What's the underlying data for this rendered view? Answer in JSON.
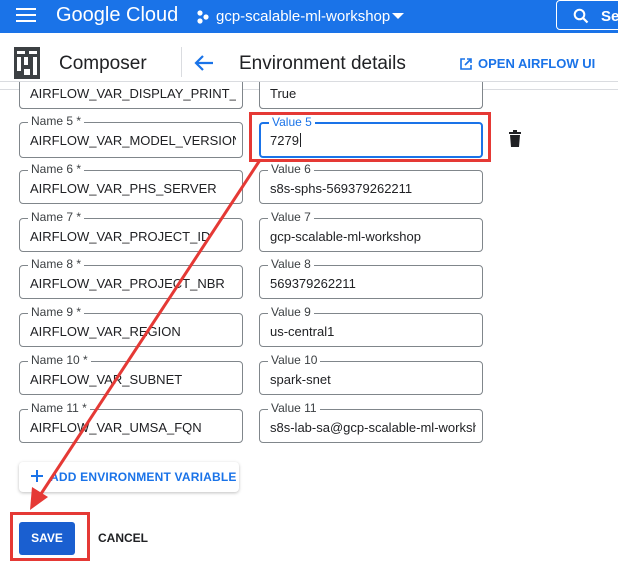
{
  "topbar": {
    "brand": "Google Cloud",
    "project": "gcp-scalable-ml-workshop",
    "search_label": "Se"
  },
  "header": {
    "product": "Composer",
    "title": "Environment details",
    "open_airflow": "OPEN AIRFLOW UI"
  },
  "env_vars": {
    "rows": [
      {
        "name_label": "",
        "name": "AIRFLOW_VAR_DISPLAY_PRINT_ST",
        "value_label": "",
        "value": "True"
      },
      {
        "name_label": "Name 5 *",
        "name": "AIRFLOW_VAR_MODEL_VERSION",
        "value_label": "Value 5",
        "value": "7279"
      },
      {
        "name_label": "Name 6 *",
        "name": "AIRFLOW_VAR_PHS_SERVER",
        "value_label": "Value 6",
        "value": "s8s-sphs-569379262211"
      },
      {
        "name_label": "Name 7 *",
        "name": "AIRFLOW_VAR_PROJECT_ID",
        "value_label": "Value 7",
        "value": "gcp-scalable-ml-workshop"
      },
      {
        "name_label": "Name 8 *",
        "name": "AIRFLOW_VAR_PROJECT_NBR",
        "value_label": "Value 8",
        "value": "569379262211"
      },
      {
        "name_label": "Name 9 *",
        "name": "AIRFLOW_VAR_REGION",
        "value_label": "Value 9",
        "value": "us-central1"
      },
      {
        "name_label": "Name 10 *",
        "name": "AIRFLOW_VAR_SUBNET",
        "value_label": "Value 10",
        "value": "spark-snet"
      },
      {
        "name_label": "Name 11 *",
        "name": "AIRFLOW_VAR_UMSA_FQN",
        "value_label": "Value 11",
        "value": "s8s-lab-sa@gcp-scalable-ml-worksh"
      }
    ]
  },
  "actions": {
    "add_env": "ADD ENVIRONMENT VARIABLE",
    "save": "SAVE",
    "cancel": "CANCEL"
  },
  "colors": {
    "accent": "#1a73e8",
    "annotation": "#e53935"
  },
  "icons": [
    "menu-icon",
    "project-icon",
    "search-icon",
    "composer-logo",
    "back-arrow-icon",
    "open-in-new-icon",
    "trash-icon",
    "plus-icon"
  ]
}
